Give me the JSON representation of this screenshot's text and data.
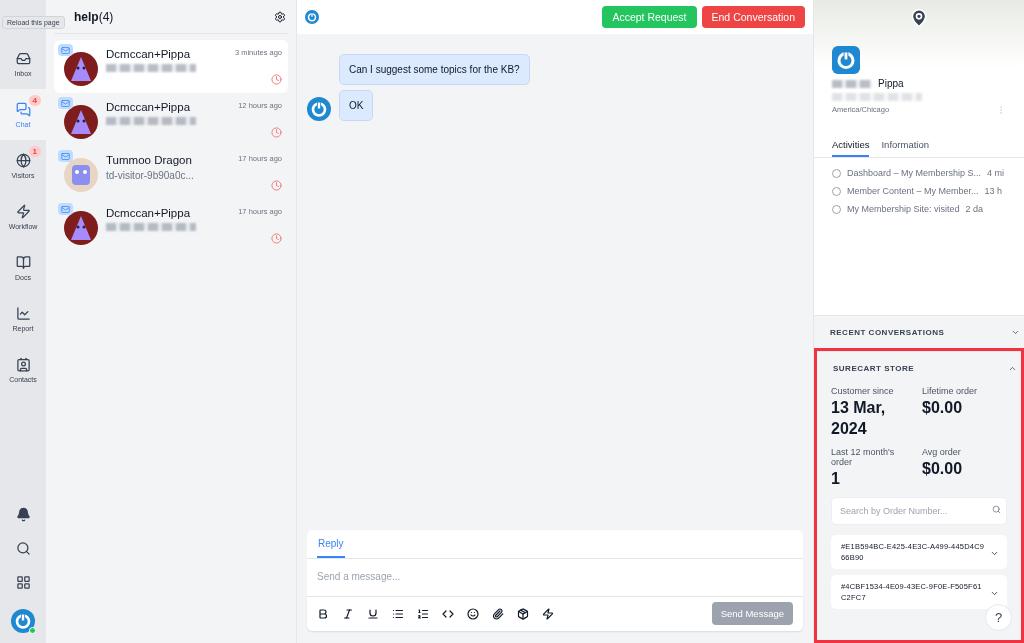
{
  "tooltip": "Reload this page",
  "nav": [
    {
      "label": "Inbox",
      "selected": false
    },
    {
      "label": "Chat",
      "badge": "4",
      "selected": true
    },
    {
      "label": "Visitors",
      "badge": "1",
      "selected": false
    },
    {
      "label": "Workflow",
      "selected": false
    },
    {
      "label": "Docs",
      "selected": false
    },
    {
      "label": "Report",
      "selected": false
    },
    {
      "label": "Contacts",
      "selected": false
    }
  ],
  "user_online": true,
  "inbox": {
    "title": "help",
    "count": "(4)"
  },
  "conversations": [
    {
      "name": "Dcmccan+Pippa",
      "time": "3 minutes ago",
      "selected": true
    },
    {
      "name": "Dcmccan+Pippa",
      "time": "12 hours ago",
      "selected": false
    },
    {
      "name": "Tummoo Dragon",
      "time": "17 hours ago",
      "preview": "td-visitor-9b90a0c...",
      "selected": false
    },
    {
      "name": "Dcmccan+Pippa",
      "time": "17 hours ago",
      "selected": false
    }
  ],
  "chat": {
    "buttons": [
      {
        "label": "Accept Request",
        "kind": "accept"
      },
      {
        "label": "End Conversation",
        "kind": "end"
      }
    ],
    "messages": [
      {
        "text": "Can I suggest some topics for the KB?",
        "avatar": false
      },
      {
        "text": "OK",
        "avatar": true
      }
    ]
  },
  "composer": {
    "tabs": [
      {
        "label": "Reply",
        "selected": true
      }
    ],
    "placeholder": "Send a message...",
    "send": {
      "label": "Send Message",
      "disabled": true
    }
  },
  "profile": {
    "name": "Pippa",
    "timezone": "America/Chicago",
    "tabs": [
      {
        "label": "Activities",
        "selected": true
      },
      {
        "label": "Information",
        "selected": false
      }
    ],
    "activities": [
      {
        "title": "Dashboard – My Membership S...",
        "time": "4 mi"
      },
      {
        "title": "Member Content – My Member...",
        "time": "13 h"
      },
      {
        "title": "My Membership Site: visited",
        "time": "2 da"
      }
    ]
  },
  "sections": [
    {
      "title": "RECENT CONVERSATIONS",
      "expanded": false
    },
    {
      "title": "SURECART STORE",
      "expanded": true
    }
  ],
  "store": {
    "stats": [
      {
        "label": "Customer since",
        "value": "13 Mar, 2024"
      },
      {
        "label": "Lifetime order",
        "value": "$0.00"
      },
      {
        "label": "Last 12 month's order",
        "value": "1"
      },
      {
        "label": "Avg order",
        "value": "$0.00"
      }
    ],
    "search_placeholder": "Search by Order Number...",
    "orders": [
      "#E1B594BC-E425-4E3C-A499-445D4C966B90",
      "#4CBF1534-4E09-43EC-9F0E-F505F61C2FC7"
    ]
  },
  "help_button": "?"
}
